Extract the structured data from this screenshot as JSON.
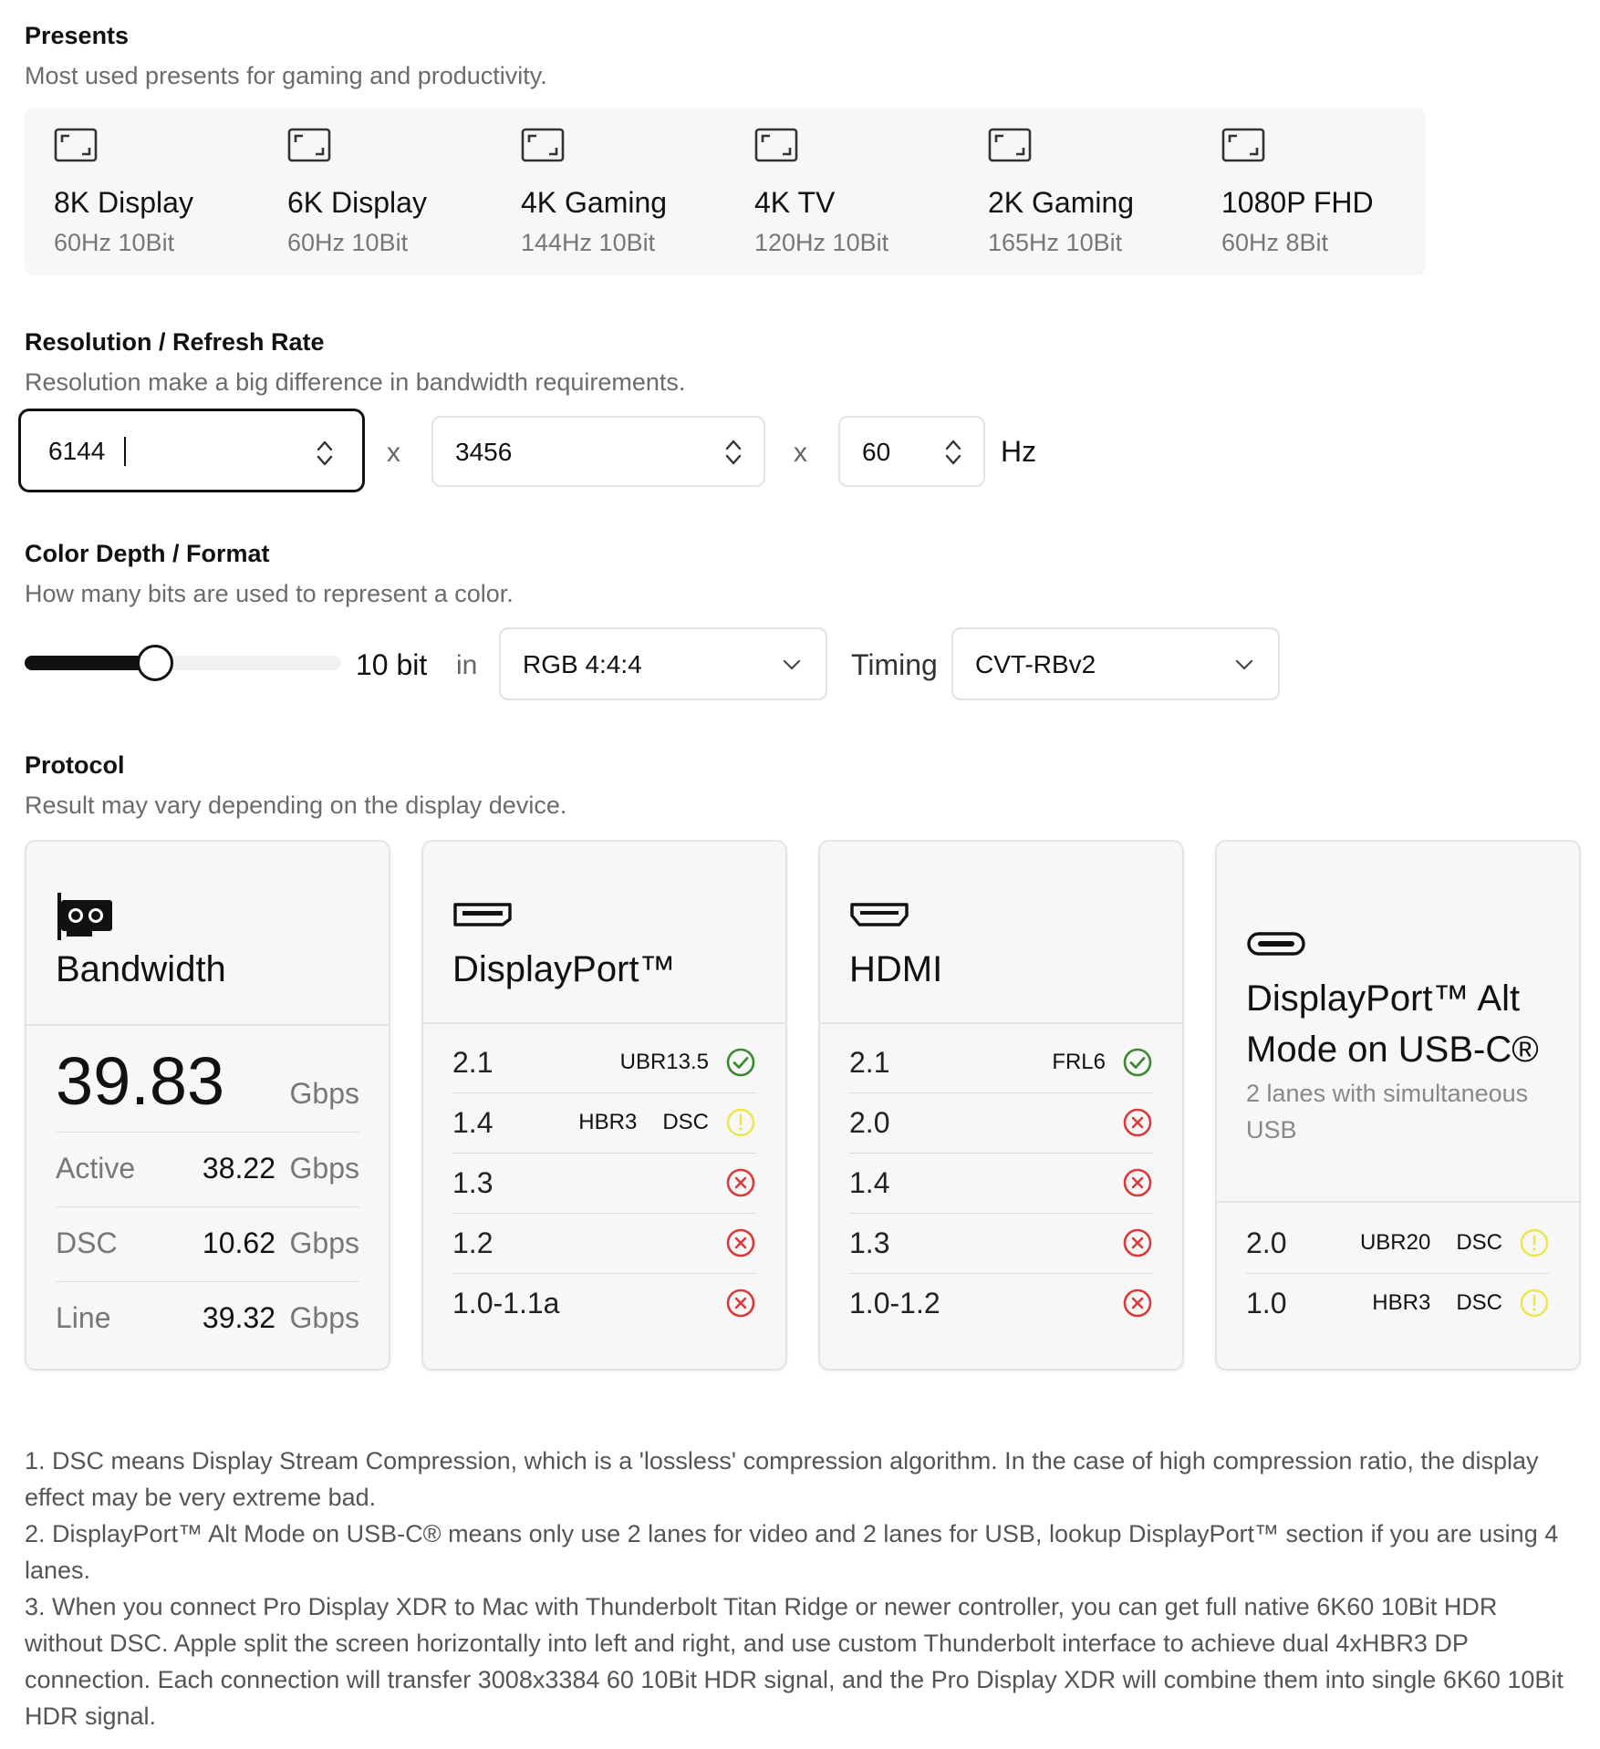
{
  "presets": {
    "title": "Presents",
    "subtitle": "Most used presents for gaming and productivity.",
    "items": [
      {
        "name": "8K Display",
        "spec": "60Hz 10Bit",
        "icon": "screen-icon"
      },
      {
        "name": "6K Display",
        "spec": "60Hz 10Bit",
        "icon": "screen-icon"
      },
      {
        "name": "4K Gaming",
        "spec": "144Hz 10Bit",
        "icon": "screen-icon"
      },
      {
        "name": "4K TV",
        "spec": "120Hz 10Bit",
        "icon": "screen-icon"
      },
      {
        "name": "2K Gaming",
        "spec": "165Hz 10Bit",
        "icon": "screen-icon"
      },
      {
        "name": "1080P FHD",
        "spec": "60Hz 8Bit",
        "icon": "screen-icon"
      }
    ]
  },
  "resolution": {
    "title": "Resolution / Refresh Rate",
    "subtitle": "Resolution make a big difference in bandwidth requirements.",
    "width": "6144",
    "height": "3456",
    "refresh": "60",
    "separator": "x",
    "unit": "Hz"
  },
  "color": {
    "title": "Color Depth / Format",
    "subtitle": "How many bits are used to represent a color.",
    "slider_level": 0.4,
    "bit_label": "10 bit",
    "in_label": "in",
    "format": "RGB 4:4:4",
    "timing_label": "Timing",
    "timing": "CVT-RBv2"
  },
  "protocol": {
    "title": "Protocol",
    "subtitle": "Result may vary depending on the display device.",
    "bandwidth": {
      "title": "Bandwidth",
      "icon": "gpu-icon",
      "total": "39.83",
      "total_unit": "Gbps",
      "rows": [
        {
          "label": "Active",
          "value": "38.22",
          "unit": "Gbps"
        },
        {
          "label": "DSC",
          "value": "10.62",
          "unit": "Gbps"
        },
        {
          "label": "Line",
          "value": "39.32",
          "unit": "Gbps"
        }
      ]
    },
    "displayport": {
      "title": "DisplayPort™",
      "icon": "displayport-icon",
      "rows": [
        {
          "version": "2.1",
          "tags": [
            "UBR13.5"
          ],
          "status": "ok"
        },
        {
          "version": "1.4",
          "tags": [
            "HBR3",
            "DSC"
          ],
          "status": "warn"
        },
        {
          "version": "1.3",
          "tags": [],
          "status": "fail"
        },
        {
          "version": "1.2",
          "tags": [],
          "status": "fail"
        },
        {
          "version": "1.0-1.1a",
          "tags": [],
          "status": "fail"
        }
      ]
    },
    "hdmi": {
      "title": "HDMI",
      "icon": "hdmi-icon",
      "rows": [
        {
          "version": "2.1",
          "tags": [
            "FRL6"
          ],
          "status": "ok"
        },
        {
          "version": "2.0",
          "tags": [],
          "status": "fail"
        },
        {
          "version": "1.4",
          "tags": [],
          "status": "fail"
        },
        {
          "version": "1.3",
          "tags": [],
          "status": "fail"
        },
        {
          "version": "1.0-1.2",
          "tags": [],
          "status": "fail"
        }
      ]
    },
    "usbc": {
      "title_line1": "DisplayPort™ Alt",
      "title_line2": "Mode on USB-C®",
      "subtitle": "2 lanes with simultaneous USB",
      "icon": "usb-c-icon",
      "rows": [
        {
          "version": "2.0",
          "tags": [
            "UBR20",
            "DSC"
          ],
          "status": "warn"
        },
        {
          "version": "1.0",
          "tags": [
            "HBR3",
            "DSC"
          ],
          "status": "warn"
        }
      ]
    }
  },
  "colors": {
    "ok": "#3a8a2f",
    "warn": "#e8e84a",
    "fail": "#d93a3a"
  },
  "notes": [
    "1. DSC means Display Stream Compression, which is a 'lossless' compression algorithm. In the case of high compression ratio, the display effect may be very extreme bad.",
    "2. DisplayPort™ Alt Mode on USB-C® means only use 2 lanes for video and 2 lanes for USB, lookup DisplayPort™ section if you are using 4 lanes.",
    "3. When you connect Pro Display XDR to Mac with Thunderbolt Titan Ridge or newer controller, you can get full native 6K60 10Bit HDR without DSC. Apple split the screen horizontally into left and right, and use custom Thunderbolt interface to achieve dual 4xHBR3 DP connection. Each connection will transfer 3008x3384 60 10Bit HDR signal, and the Pro Display XDR will combine them into single 6K60 10Bit HDR signal."
  ]
}
